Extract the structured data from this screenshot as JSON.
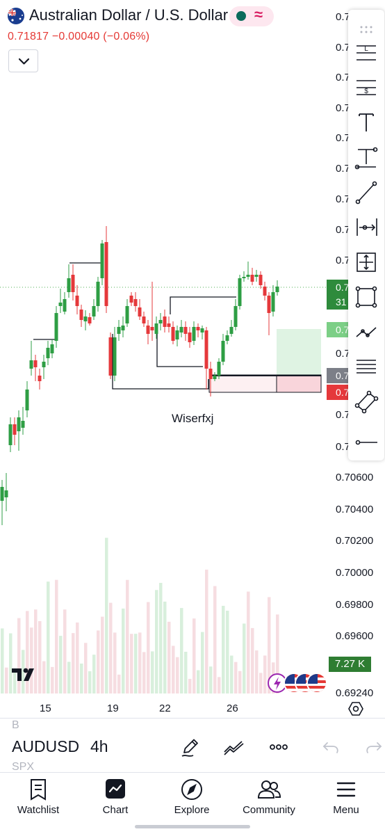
{
  "header": {
    "title": "Australian Dollar / U.S. Dollar",
    "price_line": "0.71817  −0.00040 (−0.06%)",
    "market_dot_color": "#0b6b5c",
    "pill_symbol": "≈",
    "expand_icon": "chevron-down-icon"
  },
  "toolbar": {
    "tools": [
      {
        "name": "drag-handle-icon"
      },
      {
        "name": "long-position-icon"
      },
      {
        "name": "short-position-icon"
      },
      {
        "name": "text-tool-icon"
      },
      {
        "name": "anchored-text-icon"
      },
      {
        "name": "trend-line-icon"
      },
      {
        "name": "date-range-icon"
      },
      {
        "name": "crosshair-icon"
      },
      {
        "name": "rectangle-icon"
      },
      {
        "name": "path-icon"
      },
      {
        "name": "parallel-channel-icon"
      },
      {
        "name": "rotated-rectangle-icon"
      },
      {
        "name": "horizontal-ray-icon"
      }
    ]
  },
  "price_axis": {
    "truncated_label": "0.7",
    "labels": [
      "0.70600",
      "0.70400",
      "0.70200",
      "0.70000",
      "0.69800",
      "0.69600",
      "0.69240"
    ],
    "current_price_tag": "0.7",
    "countdown_tag": "31",
    "target_tag": "0.7",
    "entry_tag": "0.7",
    "stop_tag": "0.7"
  },
  "volume_tag": "7.27 K",
  "time_axis": {
    "labels": [
      "15",
      "19",
      "22",
      "26"
    ]
  },
  "watermark": "Wiserfxj",
  "colors": {
    "up": "#26a69a",
    "candle_up": "#2e9e44",
    "candle_down": "#e5383b",
    "profit_zone": "#dff3e3",
    "loss_zone": "#fbdde2"
  },
  "symbol_bar": {
    "prev_symbol": "B",
    "symbol": "AUDUSD",
    "next_symbol": "SPX",
    "interval": "4h",
    "pencil_icon": "pencil-icon",
    "drawings_icon": "drawings-icon",
    "more_icon": "more-icon",
    "undo_icon": "undo-icon",
    "redo_icon": "redo-icon"
  },
  "nav": {
    "items": [
      {
        "label": "Watchlist",
        "icon": "watchlist-icon"
      },
      {
        "label": "Chart",
        "icon": "chart-icon"
      },
      {
        "label": "Explore",
        "icon": "compass-icon"
      },
      {
        "label": "Community",
        "icon": "community-icon"
      },
      {
        "label": "Menu",
        "icon": "hamburger-icon"
      }
    ]
  }
}
